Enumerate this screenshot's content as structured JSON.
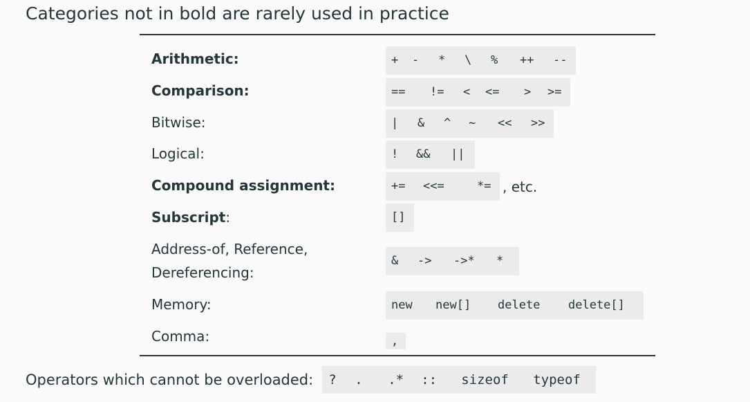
{
  "heading": "Categories not in bold are rarely used in practice",
  "rows": [
    {
      "label": "Arithmetic:",
      "label_rest": "",
      "bold": true,
      "ops": [
        "+",
        "-",
        "*",
        "\\",
        "%",
        "++",
        "--"
      ],
      "suffix": ""
    },
    {
      "label": "Comparison:",
      "label_rest": "",
      "bold": true,
      "ops": [
        "==",
        "!=",
        "<",
        "<=",
        ">",
        ">="
      ],
      "suffix": ""
    },
    {
      "label": "Bitwise:",
      "label_rest": "",
      "bold": false,
      "ops": [
        "|",
        "&",
        "^",
        "~",
        "<<",
        ">>"
      ],
      "suffix": ""
    },
    {
      "label": "Logical:",
      "label_rest": "",
      "bold": false,
      "ops": [
        "!",
        "&&",
        "||"
      ],
      "suffix": ""
    },
    {
      "label": "Compound assignment:",
      "label_rest": "",
      "bold": true,
      "ops": [
        "+=",
        "<<=",
        "*="
      ],
      "suffix": ", etc."
    },
    {
      "label": "Subscript",
      "label_rest": ":",
      "bold": true,
      "ops": [
        "[]"
      ],
      "suffix": ""
    },
    {
      "label": "Address-of, Reference,",
      "label_line2": "Dereferencing:",
      "label_rest": "",
      "bold": false,
      "ops": [
        "&",
        "->",
        "->*",
        "*"
      ],
      "suffix": ""
    },
    {
      "label": "Memory:",
      "label_rest": "",
      "bold": false,
      "ops": [
        "new",
        "new[]",
        "delete",
        "delete[]"
      ],
      "suffix": ""
    },
    {
      "label": "Comma:",
      "label_rest": "",
      "bold": false,
      "ops": [
        ","
      ],
      "suffix": ""
    }
  ],
  "footer": {
    "label": "Operators which cannot be overloaded:",
    "ops": [
      "?",
      ".",
      ".*",
      "::",
      "sizeof",
      "typeof"
    ]
  }
}
